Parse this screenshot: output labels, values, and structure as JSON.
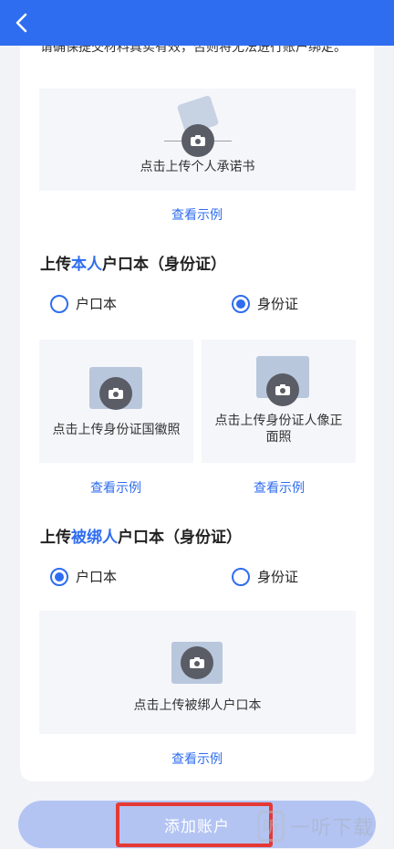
{
  "header": {
    "back_icon": "chevron-left-icon"
  },
  "notice": "请确保提交材料真实有效，否则将无法进行账户绑定。",
  "commitment": {
    "upload_label": "点击上传个人承诺书",
    "example_link": "查看示例"
  },
  "self_section": {
    "title_prefix": "上传",
    "title_highlight": "本人",
    "title_suffix": "户口本（身份证）",
    "options": [
      {
        "label": "户口本",
        "checked": false
      },
      {
        "label": "身份证",
        "checked": true
      }
    ],
    "upload_left_label": "点击上传身份证国徽照",
    "upload_right_label": "点击上传身份证人像正面照",
    "example_left": "查看示例",
    "example_right": "查看示例"
  },
  "bound_section": {
    "title_prefix": "上传",
    "title_highlight": "被绑人",
    "title_suffix": "户口本（身份证）",
    "options": [
      {
        "label": "户口本",
        "checked": true
      },
      {
        "label": "身份证",
        "checked": false
      }
    ],
    "upload_label": "点击上传被绑人户口本",
    "example_link": "查看示例"
  },
  "footer": {
    "add_button_label": "添加账户"
  },
  "watermark": {
    "logo_text": "听",
    "text": "一听下载"
  },
  "colors": {
    "primary": "#2f6df0",
    "button_disabled": "#b3c4f3",
    "highlight": "#e53935"
  }
}
